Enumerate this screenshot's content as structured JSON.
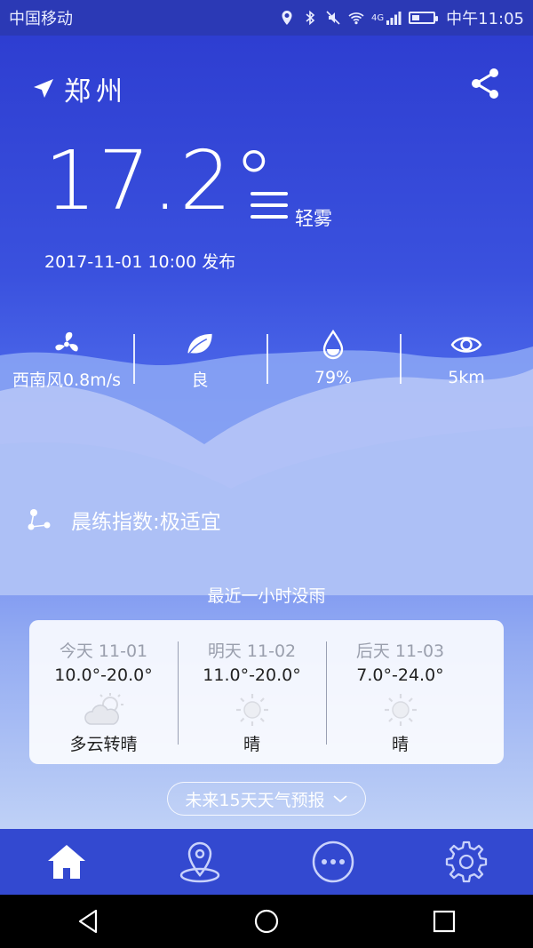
{
  "status": {
    "carrier": "中国移动",
    "network": "4G",
    "time": "中午11:05"
  },
  "location": {
    "city": "郑州"
  },
  "current": {
    "temperature": "17.2°",
    "condition": "轻雾",
    "published": "2017-11-01 10:00 发布"
  },
  "stats": [
    {
      "icon": "fan-icon",
      "value": "西南风0.8m/s"
    },
    {
      "icon": "leaf-icon",
      "value": "良"
    },
    {
      "icon": "drop-icon",
      "value": "79%"
    },
    {
      "icon": "eye-icon",
      "value": "5km"
    }
  ],
  "exercise": {
    "icon": "molecule-icon",
    "text": "晨练指数:极适宜"
  },
  "rain_notice": "最近一小时没雨",
  "forecast": [
    {
      "date": "今天 11-01",
      "range": "10.0°-20.0°",
      "icon": "cloudy-sun-icon",
      "desc": "多云转晴"
    },
    {
      "date": "明天 11-02",
      "range": "11.0°-20.0°",
      "icon": "sun-icon",
      "desc": "晴"
    },
    {
      "date": "后天 11-03",
      "range": "7.0°-24.0°",
      "icon": "sun-icon",
      "desc": "晴"
    }
  ],
  "forecast_button": "未来15天天气预报",
  "tabs": [
    {
      "icon": "home-icon",
      "active": true
    },
    {
      "icon": "location-pin-icon",
      "active": false
    },
    {
      "icon": "more-icon",
      "active": false
    },
    {
      "icon": "gear-icon",
      "active": false
    }
  ],
  "colors": {
    "accent": "#2e3ed1",
    "tabbar": "#3349d0",
    "card": "#ffffff"
  }
}
